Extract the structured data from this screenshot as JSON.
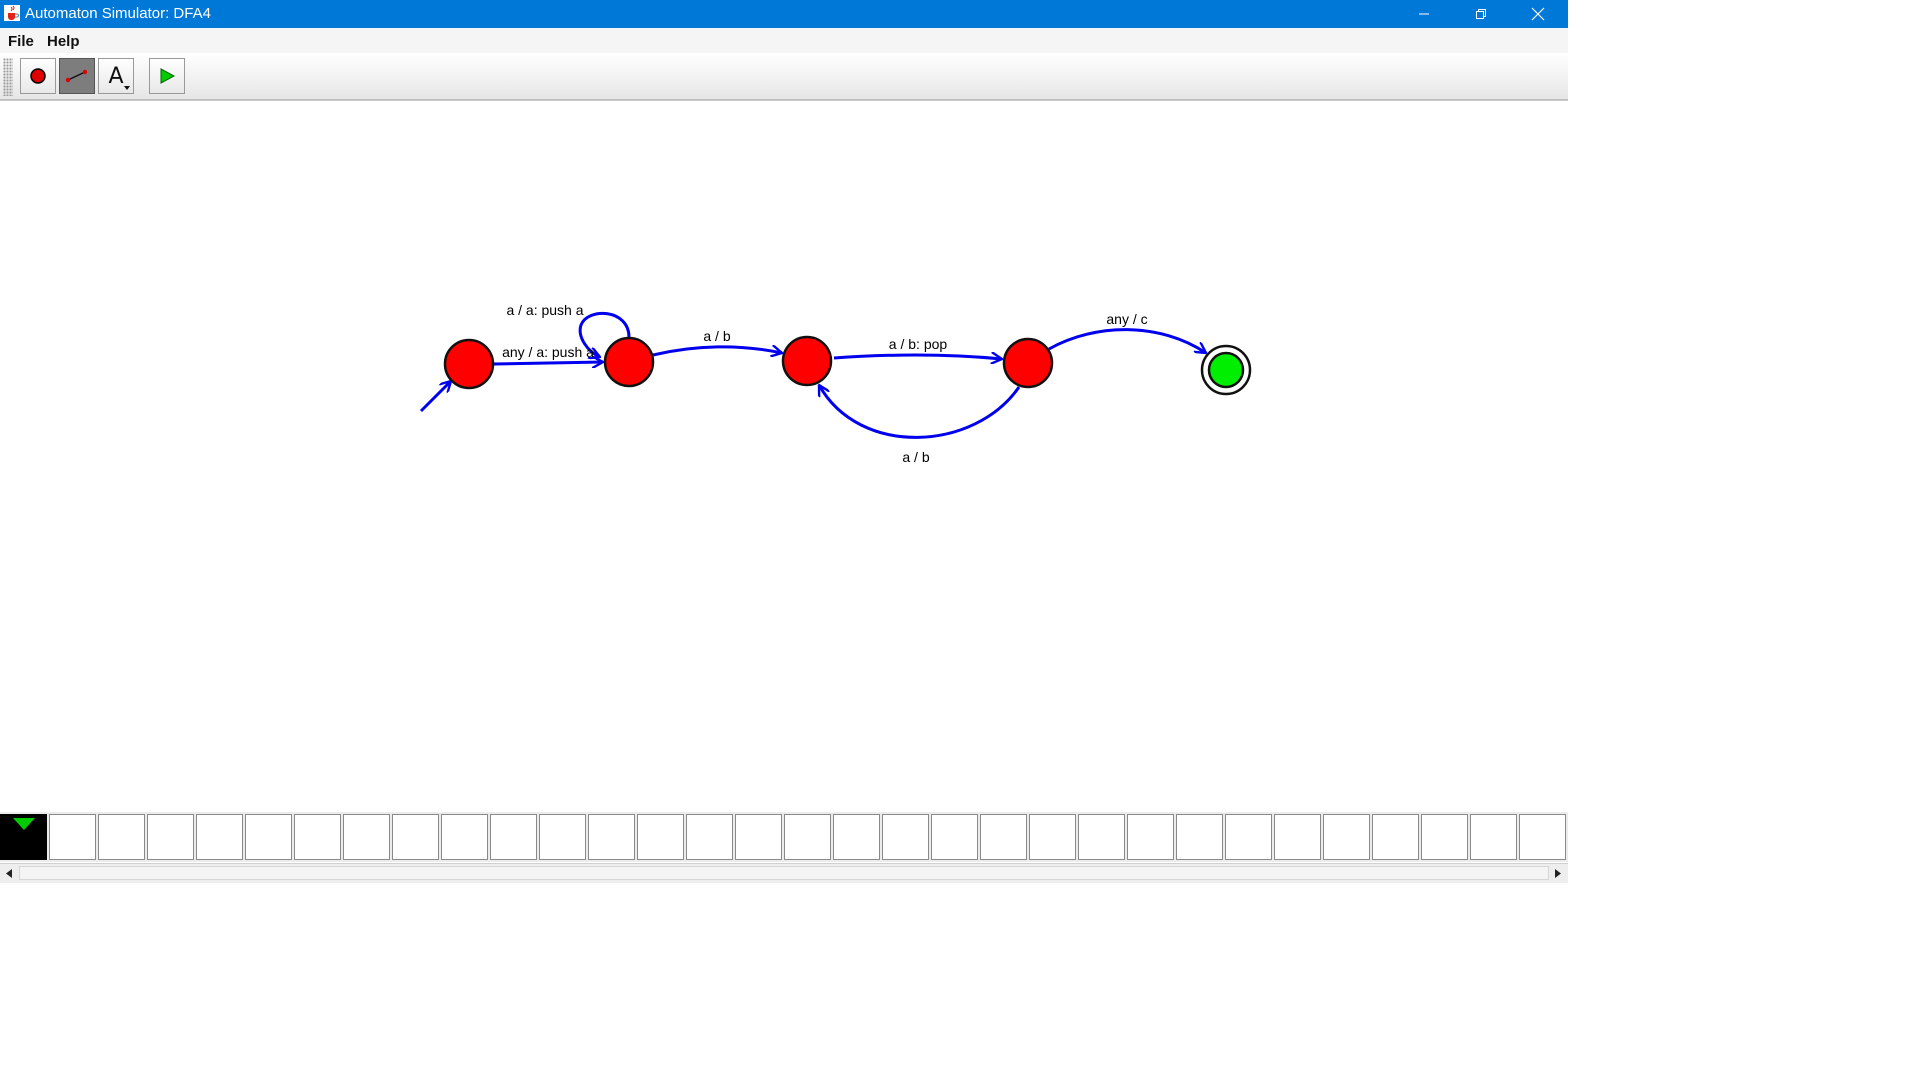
{
  "window": {
    "title": "Automaton Simulator: DFA4",
    "icons": [
      "java-cup-icon",
      "minimize-icon",
      "maximize-icon",
      "close-icon"
    ]
  },
  "menu": {
    "file": "File",
    "help": "Help"
  },
  "toolbar": {
    "tools": [
      "add-state-tool",
      "add-transition-tool",
      "add-text-tool",
      "run-simulation-tool"
    ],
    "selected": "add-transition-tool",
    "text_tool_glyph": "A"
  },
  "automaton": {
    "states": [
      {
        "id": "q0",
        "type": "start",
        "color": "#ff0000"
      },
      {
        "id": "q1",
        "type": "normal",
        "color": "#ff0000"
      },
      {
        "id": "q2",
        "type": "normal",
        "color": "#ff0000"
      },
      {
        "id": "q3",
        "type": "normal",
        "color": "#ff0000"
      },
      {
        "id": "q4",
        "type": "accept",
        "color": "#00ee00"
      }
    ],
    "transitions": [
      {
        "from": "q0",
        "to": "q1",
        "label": "any / a: push a"
      },
      {
        "from": "q1",
        "to": "q1",
        "label": "a / a: push a"
      },
      {
        "from": "q1",
        "to": "q2",
        "label": "a / b"
      },
      {
        "from": "q2",
        "to": "q3",
        "label": "a / b: pop"
      },
      {
        "from": "q3",
        "to": "q2",
        "label": "a / b"
      },
      {
        "from": "q3",
        "to": "q4",
        "label": "any / c"
      }
    ],
    "edge_color": "#0000ee"
  },
  "tape": {
    "head_position": 0,
    "head_color": "#00cc00"
  }
}
